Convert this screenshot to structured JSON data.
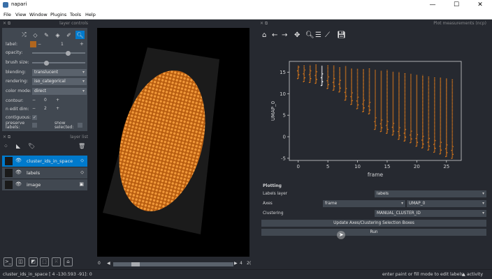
{
  "window": {
    "title": "napari",
    "minimize": "—",
    "maximize": "☐",
    "close": "✕"
  },
  "menu": [
    "File",
    "View",
    "Window",
    "Plugins",
    "Tools",
    "Help"
  ],
  "left_dock": {
    "controls_title": "layer controls",
    "list_title": "layer list",
    "label_value": "1",
    "label_color": "#b0661e",
    "controls": {
      "label": "label:",
      "opacity": "opacity:",
      "brush": "brush size:",
      "blending": "blending:",
      "blending_value": "translucent",
      "rendering": "rendering:",
      "rendering_value": "iso_categorical",
      "color_mode": "color mode:",
      "color_mode_value": "direct",
      "contour": "contour:",
      "contour_value": "0",
      "n_edit_dim": "n edit dim:",
      "n_edit_dim_value": "2",
      "contiguous": "contiguous:",
      "preserve": "preserve labels:",
      "show_selected": "show selected:"
    },
    "layers": [
      {
        "name": "cluster_ids_in_space",
        "selected": true
      },
      {
        "name": "labels",
        "selected": false
      },
      {
        "name": "image",
        "selected": false
      }
    ]
  },
  "dims": {
    "play": "◀",
    "value": "4",
    "max": "2("
  },
  "right_dock": {
    "title": "Plot measurements (ncp)",
    "plot_xlabel": "frame",
    "plot_ylabel": "UMAP_0",
    "plotting_header": "Plotting",
    "labels_layer_label": "Labels layer",
    "labels_layer_value": "labels",
    "axes_label": "Axes",
    "axes_x_value": "frame",
    "axes_y_value": "UMAP_0",
    "clustering_label": "Clustering",
    "clustering_value": "MANUAL_CLUSTER_ID",
    "update_button": "Update Axes/Clustering Selection Boxes",
    "run_button": "Run"
  },
  "status": {
    "left": "cluster_ids_in_space [ 4 -130.593 -91]: 0",
    "right": "enter paint or fill mode to edit labels",
    "activity": "▲ activity"
  },
  "chart_data": {
    "type": "scatter",
    "xlabel": "frame",
    "ylabel": "UMAP_0",
    "xlim": [
      -1.5,
      27.5
    ],
    "ylim": [
      -5.5,
      17.5
    ],
    "xticks": [
      0,
      5,
      10,
      15,
      20,
      25
    ],
    "yticks": [
      -5,
      0,
      5,
      10,
      15
    ],
    "colors": {
      "points": "#e07b1a",
      "highlight": "#ffffff",
      "axes_bg": "#262930",
      "text": "#d1d2d4"
    },
    "highlighted_frame": 4,
    "series": [
      {
        "x": [
          0,
          1,
          2,
          3,
          4,
          5,
          6,
          7,
          8,
          9,
          10,
          11,
          12,
          13,
          14,
          15,
          16,
          17,
          18,
          19,
          20,
          21,
          22,
          23,
          24,
          25,
          26
        ],
        "ymin": [
          13.5,
          12.8,
          12.6,
          12.4,
          11.9,
          11.2,
          10.8,
          10.4,
          8.5,
          7.5,
          6.5,
          5.8,
          5.3,
          1.7,
          1.2,
          0.8,
          0.4,
          -0.6,
          -1.0,
          -1.4,
          -2.2,
          -2.6,
          -3.1,
          -3.6,
          -4.0,
          -4.6,
          -5.0
        ],
        "ymax": [
          16.5,
          16.7,
          16.6,
          16.8,
          16.5,
          16.6,
          16.5,
          16.2,
          16.4,
          15.9,
          15.8,
          15.7,
          15.9,
          15.6,
          15.3,
          15.5,
          15.1,
          15.0,
          14.8,
          14.6,
          14.4,
          14.3,
          14.1,
          13.9,
          13.7,
          13.6,
          13.4
        ]
      }
    ]
  }
}
